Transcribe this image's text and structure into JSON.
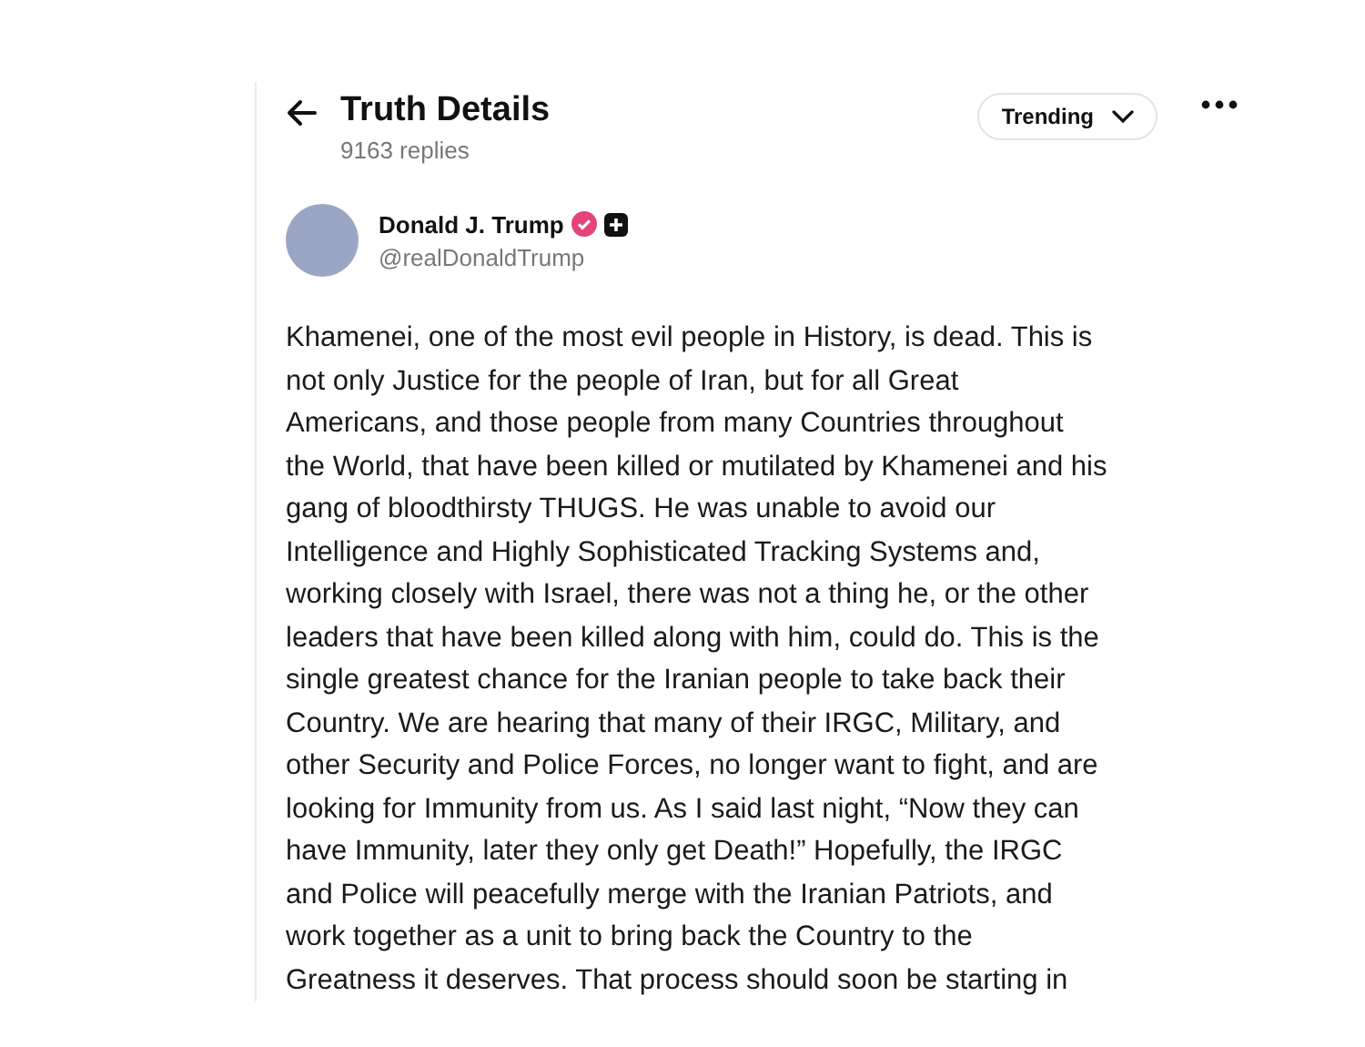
{
  "header": {
    "title": "Truth Details",
    "subtitle": "9163 replies",
    "sort": {
      "label": "Trending"
    }
  },
  "post": {
    "author": {
      "name": "Donald J. Trump",
      "verified": true,
      "handle": "@realDonaldTrump"
    },
    "text_lines": [
      "Khamenei, one of the most evil people in History, is dead. This is",
      "not only Justice for the people of Iran, but for all Great",
      "Americans, and those people from many Countries throughout",
      "the World, that have been killed or mutilated by Khamenei and his",
      "gang of bloodthirsty THUGS. He was unable to avoid our",
      "Intelligence and Highly Sophisticated Tracking Systems and,",
      "working closely with Israel, there was not a thing he, or the other",
      "leaders that have been killed along with him, could do. This is the",
      "single greatest chance for the Iranian people to take back their",
      "Country. We are hearing that many of their IRGC, Military, and",
      "other Security and Police Forces, no longer want to fight, and are",
      "looking for Immunity from us. As I said last night, “Now they can",
      "have Immunity, later they only get Death!” Hopefully, the IRGC",
      "and Police will peacefully merge with the Iranian Patriots, and",
      "work together as a unit to bring back the Country to the",
      "Greatness it deserves. That process should soon be starting in"
    ]
  }
}
